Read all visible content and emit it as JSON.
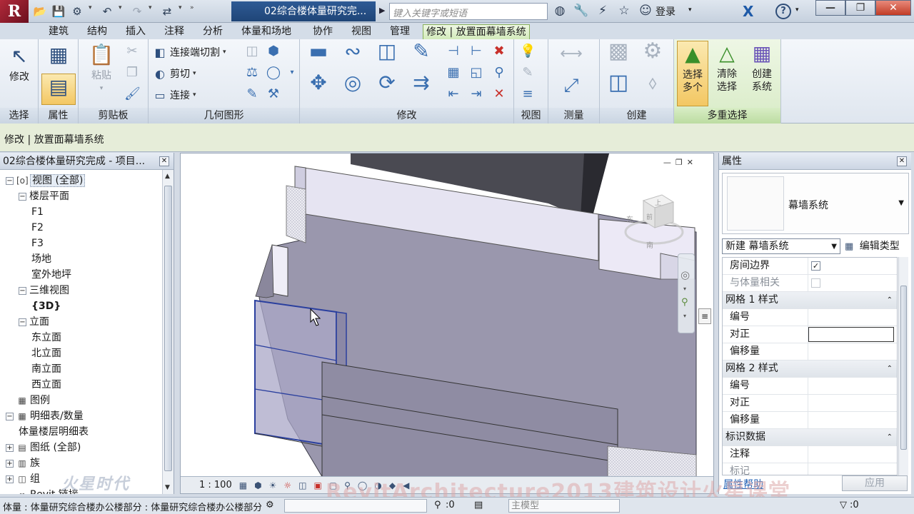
{
  "titlebar": {
    "logo_letter": "R",
    "document_title": "02综合楼体量研究完...",
    "search_placeholder": "键入关键字或短语",
    "login_label": "登录"
  },
  "tabs": [
    {
      "label": "建筑"
    },
    {
      "label": "结构"
    },
    {
      "label": "插入"
    },
    {
      "label": "注释"
    },
    {
      "label": "分析"
    },
    {
      "label": "体量和场地"
    },
    {
      "label": "协作"
    },
    {
      "label": "视图"
    },
    {
      "label": "管理"
    },
    {
      "label": "修改 | 放置面幕墙系统",
      "active": true
    }
  ],
  "ribbon": {
    "select_panel": {
      "label": "选择",
      "modify_button": "修改"
    },
    "properties_panel": {
      "label": "属性"
    },
    "clipboard_panel": {
      "label": "剪贴板",
      "paste_button": "粘贴"
    },
    "geometry_panel": {
      "label": "几何图形",
      "cut_join_button": "连接端切割",
      "cut_button": "剪切",
      "join_button": "连接"
    },
    "modify_panel": {
      "label": "修改"
    },
    "view_panel": {
      "label": "视图"
    },
    "measure_panel": {
      "label": "测量"
    },
    "create_panel": {
      "label": "创建"
    },
    "multi_select_panel": {
      "label": "多重选择",
      "select_multiple_line1": "选择",
      "select_multiple_line2": "多个",
      "clear_selection_line1": "清除",
      "clear_selection_line2": "选择",
      "create_system_line1": "创建",
      "create_system_line2": "系统"
    }
  },
  "options_bar": {
    "text": "修改 | 放置面幕墙系统"
  },
  "project_browser": {
    "title": "02综合楼体量研究完成 - 项目...",
    "tree": [
      {
        "label": "视图 (全部)",
        "level": 0,
        "toggle": "−",
        "icon": "[o]",
        "selected": true
      },
      {
        "label": "楼层平面",
        "level": 1,
        "toggle": "−"
      },
      {
        "label": "F1",
        "level": 2
      },
      {
        "label": "F2",
        "level": 2
      },
      {
        "label": "F3",
        "level": 2
      },
      {
        "label": "场地",
        "level": 2
      },
      {
        "label": "室外地坪",
        "level": 2
      },
      {
        "label": "三维视图",
        "level": 1,
        "toggle": "−"
      },
      {
        "label": "{3D}",
        "level": 2,
        "bold": true
      },
      {
        "label": "立面",
        "level": 1,
        "toggle": "−"
      },
      {
        "label": "东立面",
        "level": 2
      },
      {
        "label": "北立面",
        "level": 2
      },
      {
        "label": "南立面",
        "level": 2
      },
      {
        "label": "西立面",
        "level": 2
      },
      {
        "label": "图例",
        "level": 0,
        "icon": "▦"
      },
      {
        "label": "明细表/数量",
        "level": 0,
        "toggle": "−",
        "icon": "▦"
      },
      {
        "label": "体量楼层明细表",
        "level": 1
      },
      {
        "label": "图纸 (全部)",
        "level": 0,
        "toggle": "+",
        "icon": "▤"
      },
      {
        "label": "族",
        "level": 0,
        "toggle": "+",
        "icon": "▥"
      },
      {
        "label": "组",
        "level": 0,
        "toggle": "+",
        "icon": "◫"
      },
      {
        "label": "Revit 链接",
        "level": 0,
        "icon": "∞"
      }
    ]
  },
  "viewport": {
    "scale": "1 : 100",
    "viewcube_top": "上",
    "viewcube_front": "前",
    "compass_e": "东",
    "compass_s": "南"
  },
  "properties": {
    "title": "属性",
    "type_name": "幕墙系统",
    "instance_filter": "新建 幕墙系统",
    "edit_type_label": "编辑类型",
    "rows": [
      {
        "name": "房间边界",
        "kind": "check",
        "checked": true
      },
      {
        "name": "与体量相关",
        "kind": "check",
        "checked": false,
        "dim": true
      },
      {
        "name": "网格 1 样式",
        "kind": "group"
      },
      {
        "name": "编号",
        "kind": "value",
        "value": ""
      },
      {
        "name": "对正",
        "kind": "editing",
        "value": ""
      },
      {
        "name": "偏移量",
        "kind": "value",
        "value": ""
      },
      {
        "name": "网格 2 样式",
        "kind": "group"
      },
      {
        "name": "编号",
        "kind": "value",
        "value": ""
      },
      {
        "name": "对正",
        "kind": "value",
        "value": ""
      },
      {
        "name": "偏移量",
        "kind": "value",
        "value": ""
      },
      {
        "name": "标识数据",
        "kind": "group"
      },
      {
        "name": "注释",
        "kind": "value",
        "value": ""
      },
      {
        "name": "标记",
        "kind": "value",
        "value": "",
        "dim": true
      }
    ],
    "help_link": "属性帮助",
    "apply_button": "应用"
  },
  "statusbar": {
    "status_text": "体量 : 体量研究综合楼办公楼部分 : 体量研究综合楼办公楼部分",
    "selection_count": ":0",
    "model_label": "主模型",
    "filter_count": ":0"
  },
  "watermarks": {
    "brand": "火星时代",
    "course": "RevitArchitecture2013建筑设计火星课堂"
  },
  "colors": {
    "accent_green": "#d3ebbb",
    "title_blue": "#1f4577",
    "mass_fill": "#9a97ad",
    "selection_blue": "#2a3f9e"
  }
}
